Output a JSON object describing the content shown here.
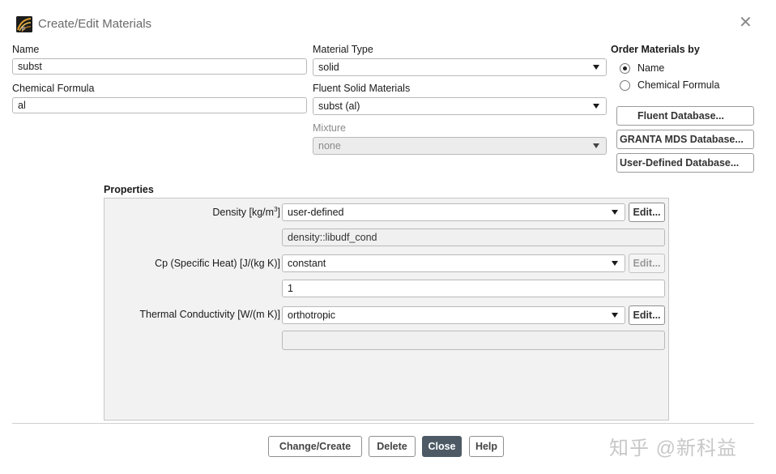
{
  "window": {
    "title": "Create/Edit Materials"
  },
  "name": {
    "label": "Name",
    "value": "subst"
  },
  "chemical_formula": {
    "label": "Chemical Formula",
    "value": "al"
  },
  "material_type": {
    "label": "Material Type",
    "value": "solid"
  },
  "fluent_solid_materials": {
    "label": "Fluent Solid Materials",
    "value": "subst (al)"
  },
  "mixture": {
    "label": "Mixture",
    "value": "none"
  },
  "order_by": {
    "label": "Order Materials by",
    "options": [
      {
        "label": "Name",
        "selected": true
      },
      {
        "label": "Chemical Formula",
        "selected": false
      }
    ]
  },
  "databases": {
    "fluent": "Fluent Database...",
    "granta": "GRANTA MDS Database...",
    "user_defined": "User-Defined Database..."
  },
  "properties": {
    "label": "Properties",
    "density": {
      "label_main": "Density [kg/m",
      "label_sup": "3",
      "label_end": "]",
      "method": "user-defined",
      "value": "density::libudf_cond",
      "edit": "Edit..."
    },
    "cp": {
      "label": "Cp (Specific Heat) [J/(kg K)]",
      "method": "constant",
      "value": "1",
      "edit": "Edit..."
    },
    "thermal_conductivity": {
      "label": "Thermal Conductivity [W/(m K)]",
      "method": "orthotropic",
      "value": "",
      "edit": "Edit..."
    }
  },
  "footer": {
    "change_create": "Change/Create",
    "delete": "Delete",
    "close": "Close",
    "help": "Help"
  },
  "watermark": "知乎 @新科益"
}
